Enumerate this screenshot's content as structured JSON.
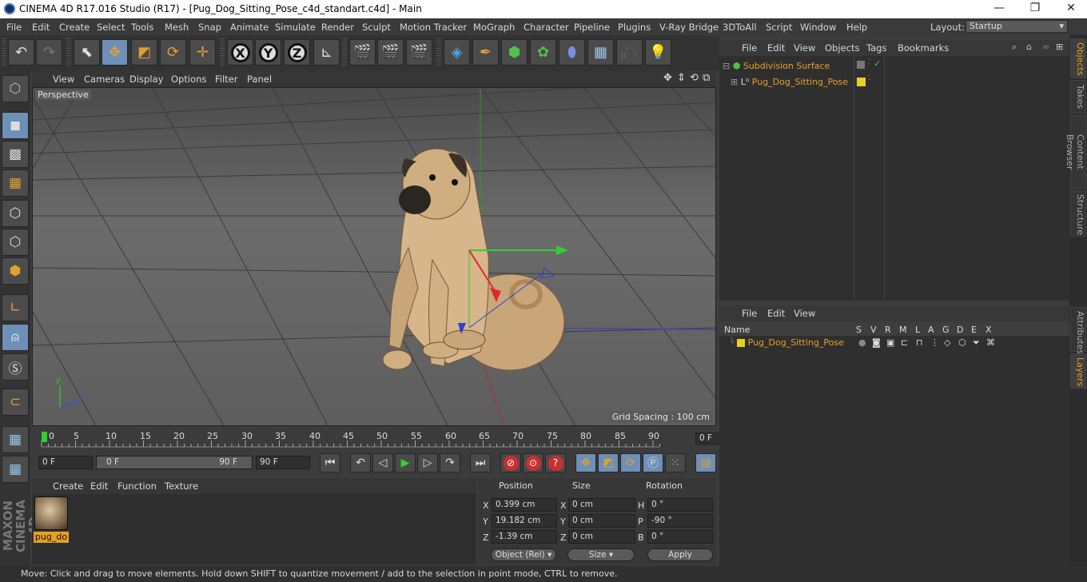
{
  "window": {
    "title": "CINEMA 4D R17.016 Studio (R17) - [Pug_Dog_Sitting_Pose_c4d_standart.c4d] - Main",
    "controls": [
      "—",
      "❐",
      "✕"
    ]
  },
  "menubar": {
    "items": [
      "File",
      "Edit",
      "Create",
      "Select",
      "Tools",
      "Mesh",
      "Snap",
      "Animate",
      "Simulate",
      "Render",
      "Sculpt",
      "Motion Tracker",
      "MoGraph",
      "Character",
      "Pipeline",
      "Plugins",
      "V-Ray Bridge",
      "3DToAll",
      "Script",
      "Window",
      "Help"
    ],
    "layout_label": "Layout:",
    "layout_value": "Startup"
  },
  "toolbar": {
    "axis_x": "X",
    "axis_y": "Y",
    "axis_z": "Z"
  },
  "viewport": {
    "menu": [
      "View",
      "Cameras",
      "Display",
      "Options",
      "Filter",
      "Panel"
    ],
    "label": "Perspective",
    "grid_spacing": "Grid Spacing : 100 cm",
    "axis_labels": {
      "y": "y",
      "x": "x",
      "z": "z"
    }
  },
  "timeline": {
    "ticks": [
      "0",
      "5",
      "10",
      "15",
      "20",
      "25",
      "30",
      "35",
      "40",
      "45",
      "50",
      "55",
      "60",
      "65",
      "70",
      "75",
      "80",
      "85",
      "90"
    ],
    "current_frame": "0 F"
  },
  "transport": {
    "start_frame": "0 F",
    "range_start": "0 F",
    "range_end": "90 F",
    "end_frame": "90 F"
  },
  "material_manager": {
    "menu": [
      "Create",
      "Edit",
      "Function",
      "Texture"
    ],
    "materials": [
      {
        "name": "pug_do"
      }
    ]
  },
  "coordinates": {
    "headers": {
      "position": "Position",
      "size": "Size",
      "rotation": "Rotation"
    },
    "rows": [
      {
        "axis": "X",
        "pos": "0.399 cm",
        "size_axis": "X",
        "size": "0 cm",
        "rot_axis": "H",
        "rot": "0 °"
      },
      {
        "axis": "Y",
        "pos": "19.182 cm",
        "size_axis": "Y",
        "size": "0 cm",
        "rot_axis": "P",
        "rot": "-90 °"
      },
      {
        "axis": "Z",
        "pos": "-1.39 cm",
        "size_axis": "Z",
        "size": "0 cm",
        "rot_axis": "B",
        "rot": "0 °"
      }
    ],
    "mode_select": "Object (Rel)",
    "size_select": "Size",
    "apply_label": "Apply"
  },
  "status": {
    "text": "Move: Click and drag to move elements. Hold down SHIFT to quantize movement / add to the selection in point mode, CTRL to remove."
  },
  "objects_panel": {
    "menu": [
      "File",
      "Edit",
      "View",
      "Objects",
      "Tags",
      "Bookmarks"
    ],
    "items": [
      {
        "name": "Subdivision Surface"
      },
      {
        "name": "Pug_Dog_Sitting_Pose"
      }
    ]
  },
  "layers_panel": {
    "menu": [
      "File",
      "Edit",
      "View"
    ],
    "columns": [
      "Name",
      "S",
      "V",
      "R",
      "M",
      "L",
      "A",
      "G",
      "D",
      "E",
      "X"
    ],
    "items": [
      {
        "name": "Pug_Dog_Sitting_Pose"
      }
    ]
  },
  "side_tabs": {
    "top": [
      "Objects",
      "Takes",
      "Content Browser",
      "Structure"
    ],
    "bottom": [
      "Attributes",
      "Layers"
    ]
  },
  "logo_text": "MAXON CINEMA 4D",
  "colors": {
    "accent": "#e8a020",
    "selected": "#6e8fb8"
  }
}
